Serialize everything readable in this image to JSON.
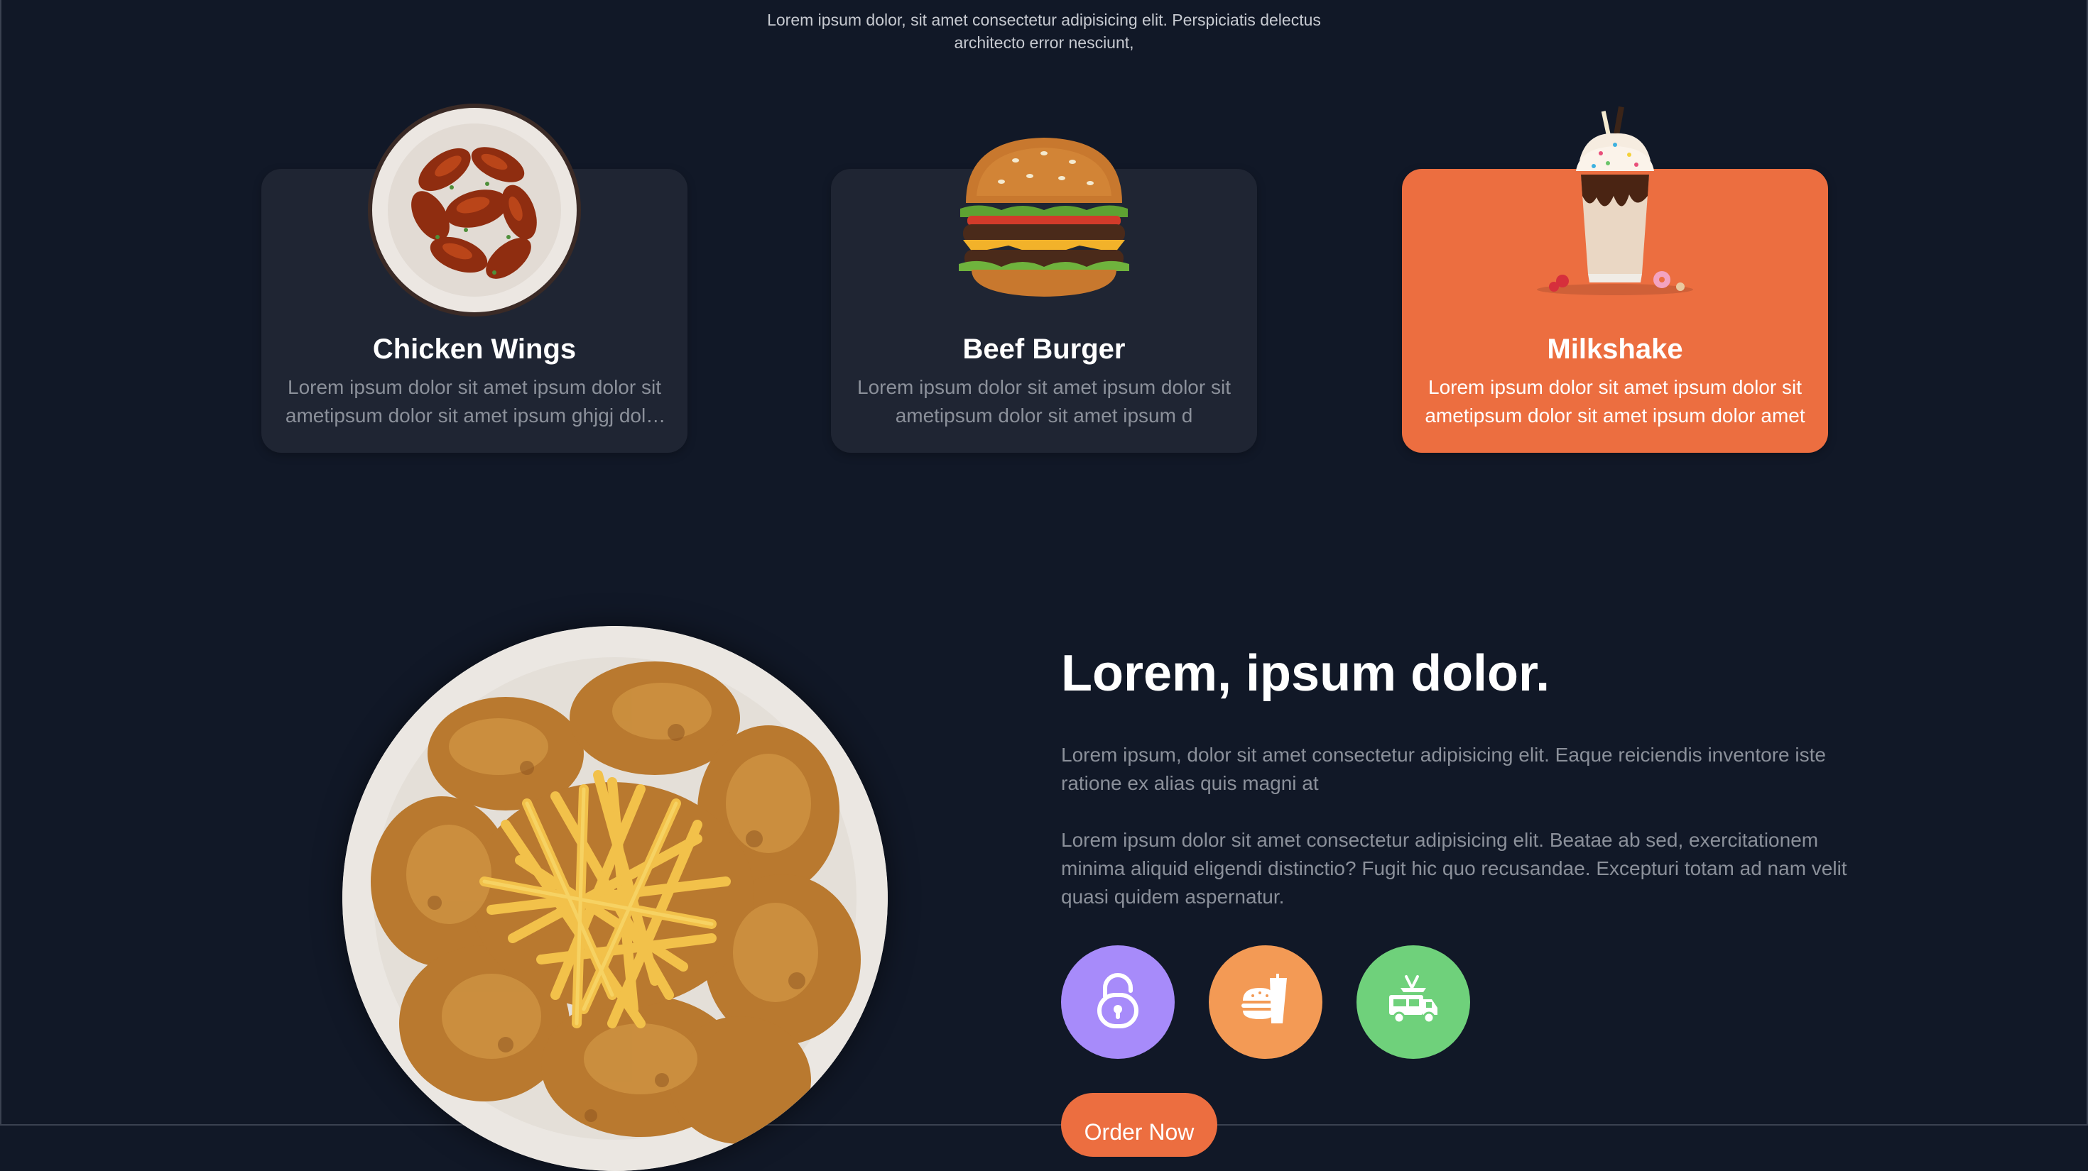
{
  "intro": {
    "text": "Lorem ipsum dolor, sit amet consectetur adipisicing elit. Perspiciatis delectus architecto error nesciunt,"
  },
  "cards": [
    {
      "title": "Chicken Wings",
      "description": "Lorem ipsum dolor sit amet ipsum dolor sit ametipsum dolor sit amet ipsum ghjgj dolor sit amet",
      "image_icon": "chicken-wings-plate-image",
      "active": false
    },
    {
      "title": "Beef Burger",
      "description": "Lorem ipsum dolor sit amet ipsum dolor sit ametipsum dolor sit amet ipsum d",
      "image_icon": "beef-burger-image",
      "active": false
    },
    {
      "title": "Milkshake",
      "description": "Lorem ipsum dolor sit amet ipsum dolor sit ametipsum dolor sit amet ipsum dolor amet",
      "image_icon": "milkshake-image",
      "active": true
    }
  ],
  "about": {
    "heading": "Lorem, ipsum dolor.",
    "paragraph1": "Lorem ipsum, dolor sit amet consectetur adipisicing elit. Eaque reiciendis inventore iste ratione ex alias quis magni at",
    "paragraph2": "Lorem ipsum dolor sit amet consectetur adipisicing elit. Beatae ab sed, exercitationem minima aliquid eligendi distinctio? Fugit hic quo recusandae. Excepturi totam ad nam velit quasi quidem aspernatur.",
    "plate_image": "fried-chicken-fries-plate-image",
    "features": [
      {
        "icon": "lock-icon",
        "color": "#a78bfa"
      },
      {
        "icon": "burger-drink-icon",
        "color": "#f39a55"
      },
      {
        "icon": "food-truck-icon",
        "color": "#6fd17b"
      }
    ],
    "order_button": "Order Now"
  },
  "colors": {
    "background": "#111827",
    "card": "#1f2533",
    "accent": "#ec6e40",
    "muted_text": "#8b909a"
  }
}
